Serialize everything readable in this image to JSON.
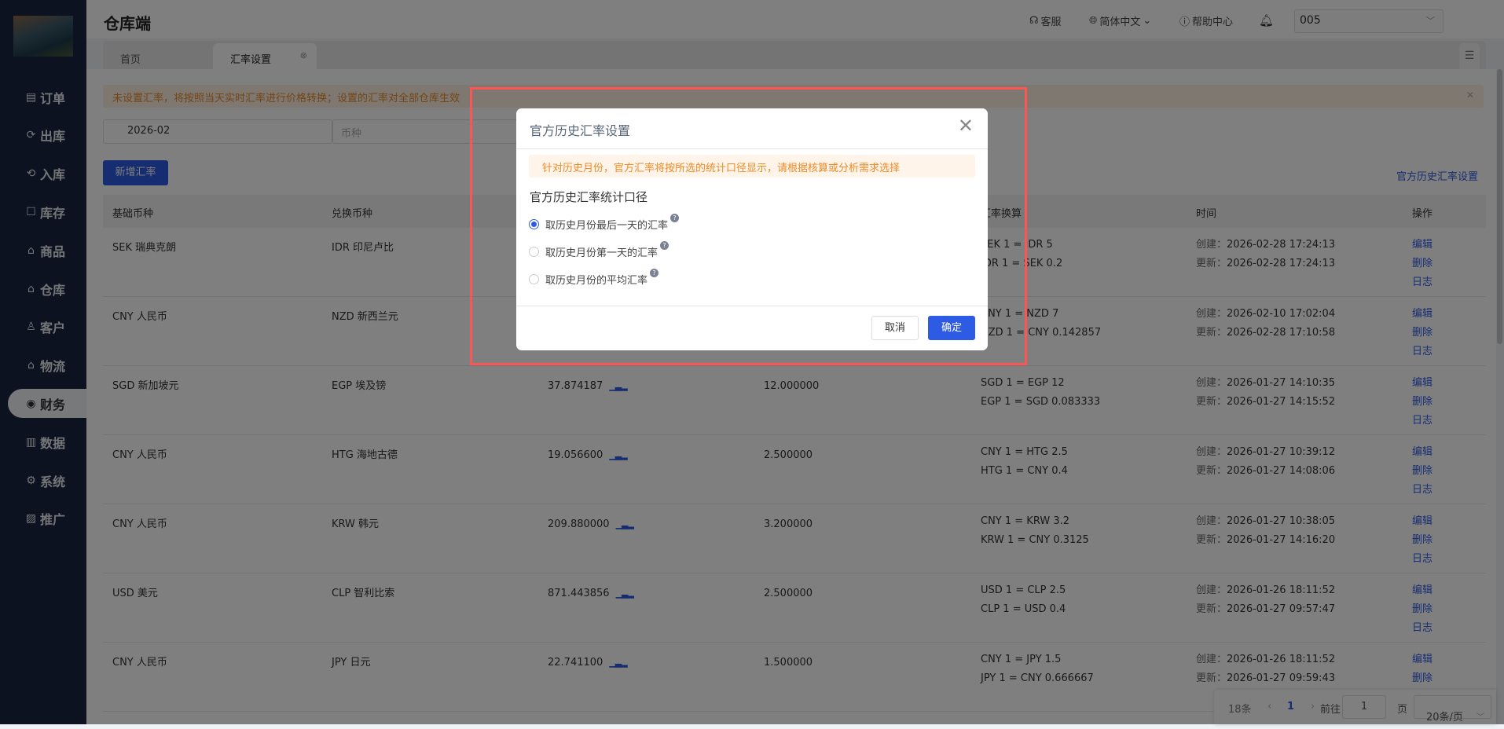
{
  "header": {
    "title": "仓库端",
    "service": "客服",
    "language": "简体中文",
    "help": "帮助中心",
    "store": "005"
  },
  "tabs": [
    {
      "label": "首页"
    },
    {
      "label": "汇率设置"
    }
  ],
  "sidebar": {
    "items": [
      {
        "label": "订单",
        "icon": "▤"
      },
      {
        "label": "出库",
        "icon": "⟳"
      },
      {
        "label": "入库",
        "icon": "⟲"
      },
      {
        "label": "库存",
        "icon": "☐"
      },
      {
        "label": "商品",
        "icon": "⌂"
      },
      {
        "label": "仓库",
        "icon": "⌂"
      },
      {
        "label": "客户",
        "icon": "♙"
      },
      {
        "label": "物流",
        "icon": "⌂"
      },
      {
        "label": "财务",
        "icon": "◉"
      },
      {
        "label": "数据",
        "icon": "▥"
      },
      {
        "label": "系统",
        "icon": "⚙"
      },
      {
        "label": "推广",
        "icon": "▨"
      }
    ],
    "active": 8
  },
  "alert": "未设置汇率，将按照当天实时汇率进行价格转换；设置的汇率对全部仓库生效",
  "filters": {
    "month": "2026-02",
    "currency_placeholder": "币种"
  },
  "actions": {
    "add": "新增汇率",
    "history_link": "官方历史汇率设置"
  },
  "table": {
    "headers": [
      "基础币种",
      "兑换币种",
      "汇率换算",
      "时间",
      "操作"
    ],
    "ops": [
      "编辑",
      "删除",
      "日志"
    ],
    "created_label": "创建：",
    "updated_label": "更新：",
    "rows": [
      {
        "base": "SEK 瑞典克朗",
        "target": "IDR 印尼卢比",
        "official": "",
        "rate": "",
        "conv": [
          "SEK 1 = IDR 5",
          "IDR 1 = SEK 0.2"
        ],
        "created": "2026-02-28 17:24:13",
        "updated": "2026-02-28 17:24:13"
      },
      {
        "base": "CNY 人民币",
        "target": "NZD 新西兰元",
        "official": "",
        "rate": "",
        "conv": [
          "CNY 1 = NZD 7",
          "NZD 1 = CNY 0.142857"
        ],
        "created": "2026-02-10 17:02:04",
        "updated": "2026-02-28 17:10:58"
      },
      {
        "base": "SGD 新加坡元",
        "target": "EGP 埃及镑",
        "official": "37.874187",
        "rate": "12.000000",
        "conv": [
          "SGD 1 = EGP 12",
          "EGP 1 = SGD 0.083333"
        ],
        "created": "2026-01-27 14:10:35",
        "updated": "2026-01-27 14:15:52"
      },
      {
        "base": "CNY 人民币",
        "target": "HTG 海地古德",
        "official": "19.056600",
        "rate": "2.500000",
        "conv": [
          "CNY 1 = HTG 2.5",
          "HTG 1 = CNY 0.4"
        ],
        "created": "2026-01-27 10:39:12",
        "updated": "2026-01-27 14:08:06"
      },
      {
        "base": "CNY 人民币",
        "target": "KRW 韩元",
        "official": "209.880000",
        "rate": "3.200000",
        "conv": [
          "CNY 1 = KRW 3.2",
          "KRW 1 = CNY 0.3125"
        ],
        "created": "2026-01-27 10:38:05",
        "updated": "2026-01-27 14:16:20"
      },
      {
        "base": "USD 美元",
        "target": "CLP 智利比索",
        "official": "871.443856",
        "rate": "2.500000",
        "conv": [
          "USD 1 = CLP 2.5",
          "CLP 1 = USD 0.4"
        ],
        "created": "2026-01-26 18:11:52",
        "updated": "2026-01-27 09:57:47"
      },
      {
        "base": "CNY 人民币",
        "target": "JPY 日元",
        "official": "22.741100",
        "rate": "1.500000",
        "conv": [
          "CNY 1 = JPY 1.5",
          "JPY 1 = CNY 0.666667"
        ],
        "created": "2026-01-26 18:11:52",
        "updated": "2026-01-27 09:59:43"
      }
    ]
  },
  "pagination": {
    "total": "18条",
    "current": "1",
    "goto_label": "前往",
    "goto_value": "1",
    "page_unit": "页",
    "page_size": "20条/页"
  },
  "modal": {
    "title": "官方历史汇率设置",
    "notice": "针对历史月份，官方汇率将按所选的统计口径显示，请根据核算或分析需求选择",
    "label": "官方历史汇率统计口径",
    "options": [
      {
        "label": "取历史月份最后一天的汇率",
        "checked": true
      },
      {
        "label": "取历史月份第一天的汇率",
        "checked": false
      },
      {
        "label": "取历史月份的平均汇率",
        "checked": false
      }
    ],
    "cancel": "取消",
    "confirm": "确定"
  },
  "colors": {
    "primary": "#2d5be3",
    "warning": "#f08a24",
    "highlight": "#ff5454"
  }
}
